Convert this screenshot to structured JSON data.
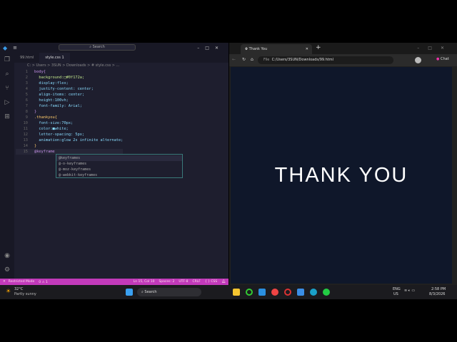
{
  "vscode": {
    "search": "Search",
    "tabs": [
      "99.html",
      "style.css  1"
    ],
    "breadcrumb": "C: > Users > 3SUN > Downloads > # style.css > ...",
    "code": [
      {
        "n": "1",
        "t": "body{",
        "c": "sel"
      },
      {
        "n": "2",
        "t": "  background:□#0f172a;",
        "c": "val"
      },
      {
        "n": "3",
        "t": "  display:flex;",
        "c": "pr"
      },
      {
        "n": "4",
        "t": "  justify-content: center;",
        "c": "pr"
      },
      {
        "n": "5",
        "t": "  align-items: center;",
        "c": "pr"
      },
      {
        "n": "6",
        "t": "  height:100vh;",
        "c": "pr"
      },
      {
        "n": "7",
        "t": "  font-family: Arial;",
        "c": "pr"
      },
      {
        "n": "8",
        "t": "}",
        "c": "sel"
      },
      {
        "n": "9",
        "t": ".thankyou{",
        "c": "br"
      },
      {
        "n": "10",
        "t": "  font-size:70px;",
        "c": "pr"
      },
      {
        "n": "11",
        "t": "  color:■white;",
        "c": "pr"
      },
      {
        "n": "12",
        "t": "  letter-spacing: 5px;",
        "c": "pr"
      },
      {
        "n": "13",
        "t": "  animation:glow 2s infinite alternate;",
        "c": "pr"
      },
      {
        "n": "14",
        "t": "}",
        "c": "br"
      },
      {
        "n": "15",
        "t": "@keyframe",
        "c": "sel"
      }
    ],
    "suggestions": [
      "@keyframes",
      "@-o-keyframes",
      "@-moz-keyframes",
      "@-webkit-keyframes"
    ],
    "status": {
      "mode": "Restricted Mode",
      "problems": "⑘0 ⚠ 1",
      "position": "Ln 15, Col 10",
      "spaces": "Spaces: 2",
      "encoding": "UTF-8",
      "eol": "CRLF",
      "language": "{ } CSS"
    }
  },
  "browser": {
    "tab_title": "Thank You",
    "url_prefix": "File",
    "url": "C:/Users/3SUN/Downloads/99.html",
    "chat": "Chat",
    "page_text": "THANK YOU"
  },
  "taskbar": {
    "temp": "32°C",
    "weather": "Partly sunny",
    "search": "Search",
    "lang1": "ENG",
    "lang2": "US",
    "time": "2:58 PM",
    "date": "8/3/2026"
  }
}
